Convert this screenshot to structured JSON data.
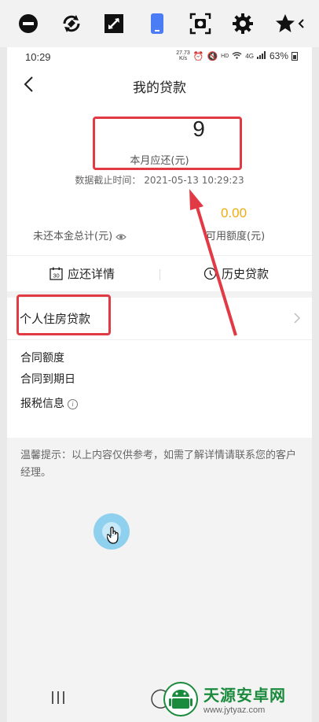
{
  "toolbar": {
    "icons": [
      "minus-circle-icon",
      "rotate-icon",
      "expand-icon",
      "phone-icon",
      "screenshot-icon",
      "gear-icon",
      "star-icon"
    ],
    "active_color": "#4a7cf6"
  },
  "status_bar": {
    "time": "10:29",
    "net_speed": "27.73",
    "net_unit": "K/s",
    "hd": "HD",
    "signal": "4G",
    "battery": "63%"
  },
  "nav": {
    "title": "我的贷款"
  },
  "summary": {
    "amount": "9",
    "amount_label": "本月应还(元)",
    "cutoff_label": "数据截止时间：",
    "cutoff_time": "2021-05-13 10:29:23",
    "unpaid_label": "未还本金总计(元)",
    "available_value": "0.00",
    "available_label": "可用额度(元)"
  },
  "tabs": [
    {
      "label": "应还详情",
      "icon": "calendar-icon"
    },
    {
      "label": "历史贷款",
      "icon": "clock-icon"
    }
  ],
  "loan": {
    "title": "个人住房贷款",
    "rows": [
      "合同额度",
      "合同到期日",
      "报税信息"
    ]
  },
  "tip": "温馨提示：以上内容仅供参考，如需了解详情请联系您的客户经理。",
  "colors": {
    "annotation_red": "#e23a45",
    "available_gold": "#f0ac10"
  },
  "watermark": {
    "title": "天源安卓网",
    "url": "www.jytyaz.com"
  }
}
